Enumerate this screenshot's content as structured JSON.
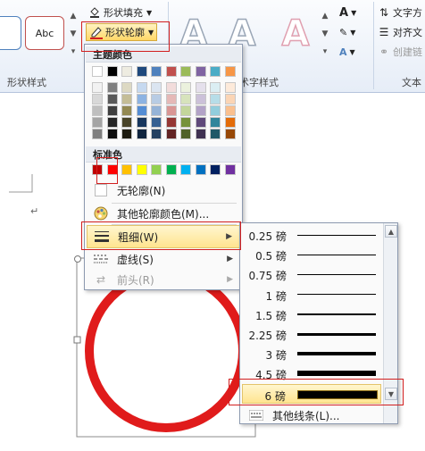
{
  "ribbon": {
    "style_preview_label": "Abc",
    "fill_label": "形状填充",
    "outline_label": "形状轮廓",
    "shape_styles_label": "形状样式",
    "wordart_styles_label": "术字样式",
    "text_direction_label": "文字方",
    "align_text_label": "对齐文",
    "create_link_label": "创建链",
    "text_group_label": "文本",
    "letter_a": "A"
  },
  "color_menu": {
    "theme_colors_label": "主题颜色",
    "standard_colors_label": "标准色",
    "no_outline_label": "无轮廓(N)",
    "more_colors_label": "其他轮廓颜色(M)...",
    "weight_label": "粗细(W)",
    "dashes_label": "虚线(S)",
    "arrows_label": "前头(R)",
    "theme_top_row": [
      "#ffffff",
      "#000000",
      "#eeece1",
      "#1f497d",
      "#4f81bd",
      "#c0504d",
      "#9bbb59",
      "#8064a2",
      "#4bacc6",
      "#f79646"
    ],
    "theme_shades": [
      [
        "#f2f2f2",
        "#7f7f7f",
        "#ddd9c3",
        "#c6d9f0",
        "#dbe5f1",
        "#f2dcdb",
        "#ebf1dd",
        "#e5e0ec",
        "#dbeef3",
        "#fdeada"
      ],
      [
        "#d8d8d8",
        "#595959",
        "#c4bd97",
        "#8db3e2",
        "#b8cce4",
        "#e5b9b7",
        "#d7e3bc",
        "#ccc1d9",
        "#b7dde8",
        "#fbd5b5"
      ],
      [
        "#bfbfbf",
        "#3f3f3f",
        "#938953",
        "#548dd4",
        "#95b3d7",
        "#d99694",
        "#c3d69b",
        "#b2a2c7",
        "#92cddc",
        "#fac08f"
      ],
      [
        "#a5a5a5",
        "#262626",
        "#494429",
        "#17365d",
        "#366092",
        "#953734",
        "#76923c",
        "#5f497a",
        "#31859b",
        "#e36c09"
      ],
      [
        "#7f7f7f",
        "#0c0c0c",
        "#1d1b10",
        "#0f243e",
        "#244061",
        "#632423",
        "#4f6128",
        "#3f3151",
        "#205867",
        "#974806"
      ]
    ],
    "standard_colors": [
      "#c00000",
      "#ff0000",
      "#ffc000",
      "#ffff00",
      "#92d050",
      "#00b050",
      "#00b0f0",
      "#0070c0",
      "#002060",
      "#7030a0"
    ]
  },
  "weight_menu": {
    "options": [
      {
        "label": "0.25 磅",
        "pt": 0.25
      },
      {
        "label": "0.5 磅",
        "pt": 0.5
      },
      {
        "label": "0.75 磅",
        "pt": 0.75
      },
      {
        "label": "1 磅",
        "pt": 1
      },
      {
        "label": "1.5 磅",
        "pt": 1.5
      },
      {
        "label": "2.25 磅",
        "pt": 2.25
      },
      {
        "label": "3 磅",
        "pt": 3
      },
      {
        "label": "4.5 磅",
        "pt": 4.5
      },
      {
        "label": "6 磅",
        "pt": 6
      }
    ],
    "more_lines_label": "其他线条(L)..."
  },
  "colors": {
    "accent_red": "#d21f1f",
    "circle_red": "#e01b1b",
    "highlight_yellow": "#ffe48f"
  }
}
